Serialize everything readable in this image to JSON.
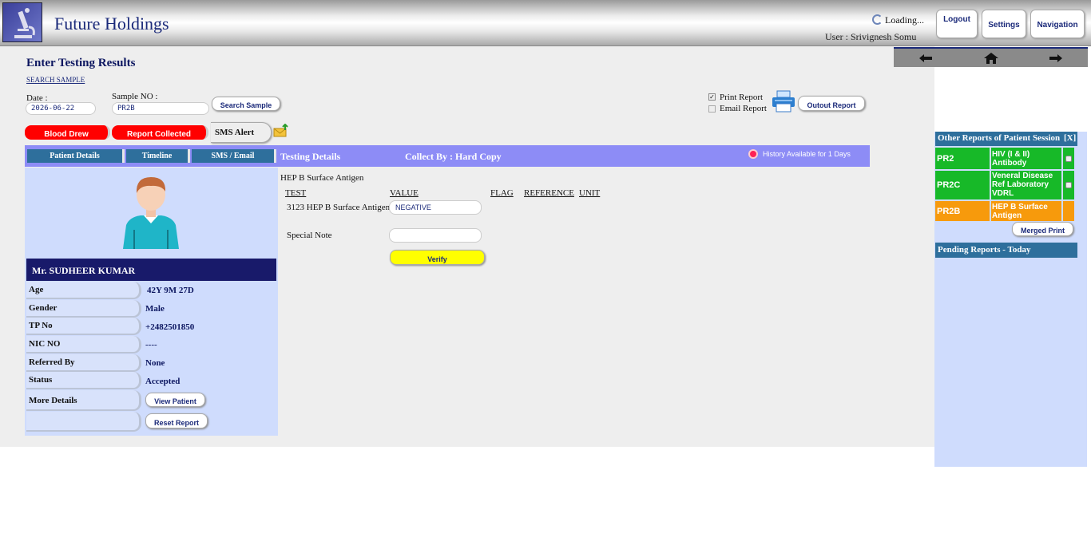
{
  "header": {
    "company": "Future Holdings",
    "loading": "Loading...",
    "user": "User : Srivignesh Somu",
    "buttons": {
      "logout": "Logout",
      "settings": "Settings",
      "navigation": "Navigation"
    }
  },
  "page": {
    "title": "Enter Testing Results",
    "search_link": "SEARCH SAMPLE",
    "date_label": "Date :",
    "date_value": "2026-06-22",
    "sample_label": "Sample NO :",
    "sample_value": "PR2B",
    "search_button": "Search Sample",
    "print_report": "Print Report",
    "email_report": "Email Report",
    "output_button": "Outout Report",
    "blood_drew": "Blood Drew",
    "report_collected": "Report Collected",
    "sms_alert": "SMS Alert"
  },
  "tabs": {
    "patient_details": "Patient Details",
    "timeline": "Timeline",
    "sms_email": "SMS / Email",
    "testing_details": "Testing Details",
    "collect_by": "Collect By : Hard Copy",
    "history": "History Available for 1 Days"
  },
  "patient": {
    "name": "Mr. SUDHEER KUMAR",
    "fields": [
      {
        "label": "Age",
        "value": "42Y 9M 27D"
      },
      {
        "label": "Gender",
        "value": "Male"
      },
      {
        "label": "TP No",
        "value": "+2482501850"
      },
      {
        "label": "NIC NO",
        "value": "----"
      },
      {
        "label": "Referred By",
        "value": "None"
      },
      {
        "label": "Status",
        "value": "Accepted"
      }
    ],
    "more_details_label": "More Details",
    "view_patient": "View Patient",
    "reset_report": "Reset Report"
  },
  "test": {
    "group_title": "HEP B Surface Antigen",
    "columns": [
      "TEST",
      "VALUE",
      "FLAG",
      "REFERENCE",
      "UNIT"
    ],
    "row_test": "3123 HEP B Surface Antigen",
    "row_value": "NEGATIVE",
    "special_note_label": "Special Note",
    "verify": "Verify"
  },
  "right": {
    "other_reports_title": "Other Reports of Patient Session",
    "close": "[X]",
    "reports": [
      {
        "id": "PR2",
        "name": "HIV (I & II) Antibody",
        "color": "#17b928"
      },
      {
        "id": "PR2C",
        "name": "Veneral Disease Ref Laboratory VDRL",
        "color": "#17b928"
      },
      {
        "id": "PR2B",
        "name": "HEP B Surface Antigen",
        "color": "#f79a0c"
      }
    ],
    "merged_print": "Merged Print",
    "pending_title": "Pending Reports - Today"
  }
}
